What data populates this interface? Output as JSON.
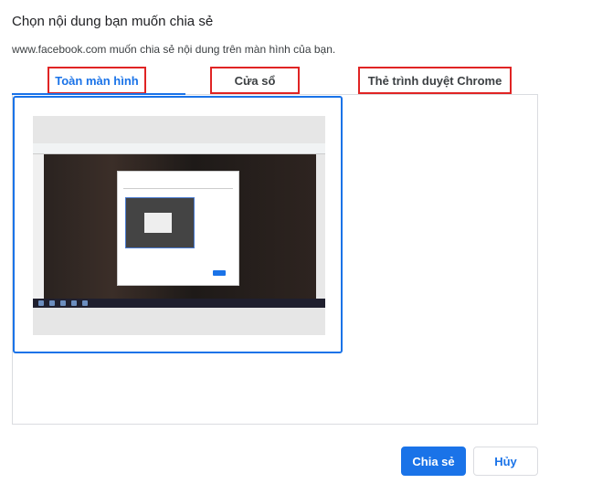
{
  "dialog": {
    "title": "Chọn nội dung bạn muốn chia sẻ",
    "subtitle": "www.facebook.com muốn chia sẻ nội dung trên màn hình của bạn."
  },
  "tabs": [
    {
      "label": "Toàn màn hình",
      "active": true
    },
    {
      "label": "Cửa sổ",
      "active": false
    },
    {
      "label": "Thẻ trình duyệt Chrome",
      "active": false
    }
  ],
  "buttons": {
    "share_label": "Chia sẻ",
    "cancel_label": "Hủy"
  },
  "colors": {
    "accent": "#1a73e8",
    "highlight_border": "#e02424"
  }
}
